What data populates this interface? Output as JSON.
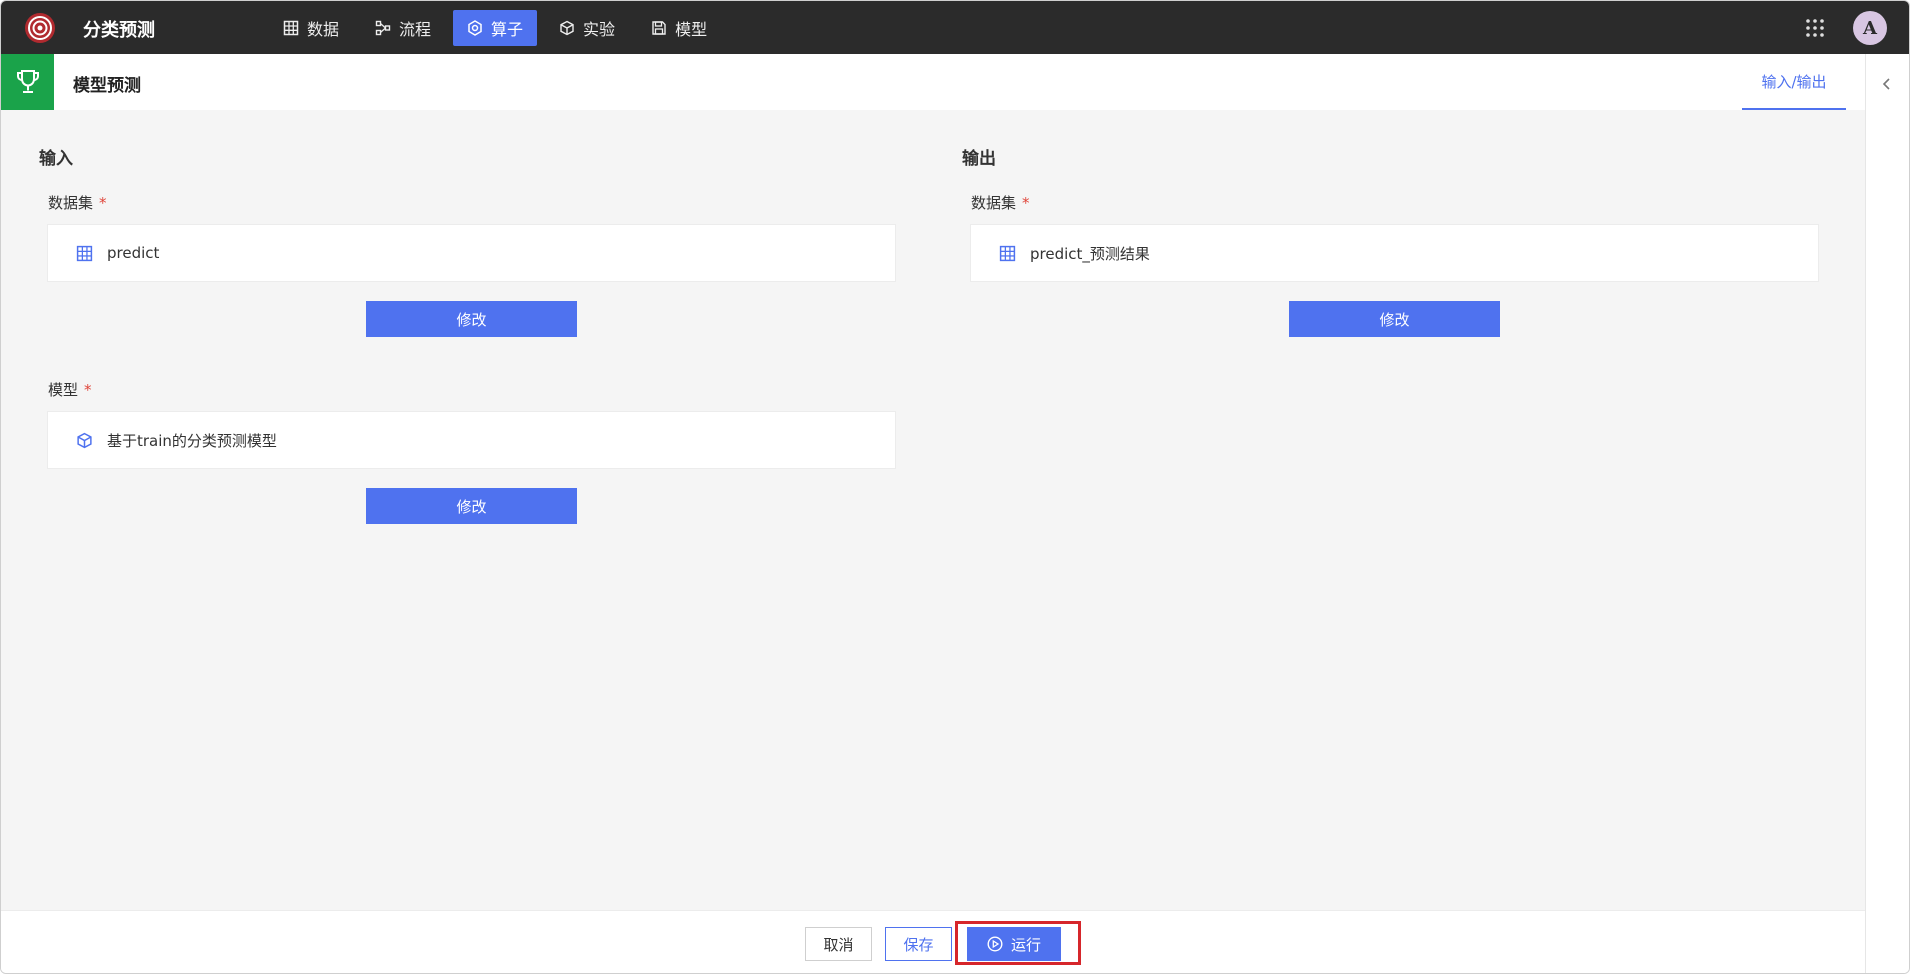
{
  "app": {
    "title": "分类预测"
  },
  "nav": [
    {
      "label": "数据",
      "icon": "table-icon",
      "active": false
    },
    {
      "label": "流程",
      "icon": "flow-icon",
      "active": false
    },
    {
      "label": "算子",
      "icon": "operator-icon",
      "active": true
    },
    {
      "label": "实验",
      "icon": "cube-icon",
      "active": false
    },
    {
      "label": "模型",
      "icon": "save-icon",
      "active": false
    }
  ],
  "user": {
    "avatar_letter": "A"
  },
  "header": {
    "title": "模型预测",
    "tab_label": "输入/输出"
  },
  "input": {
    "title": "输入",
    "dataset_label": "数据集",
    "dataset_value": "predict",
    "model_label": "模型",
    "model_value": "基于train的分类预测模型",
    "edit_label": "修改"
  },
  "output": {
    "title": "输出",
    "dataset_label": "数据集",
    "dataset_value": "predict_预测结果",
    "edit_label": "修改"
  },
  "required_mark": "*",
  "footer": {
    "cancel_label": "取消",
    "save_label": "保存",
    "run_label": "运行"
  },
  "colors": {
    "accent": "#4f72ef",
    "topbar": "#2b2b2b",
    "trophy": "#1aa34a",
    "highlight": "#d6262b",
    "required": "#e0463b"
  }
}
